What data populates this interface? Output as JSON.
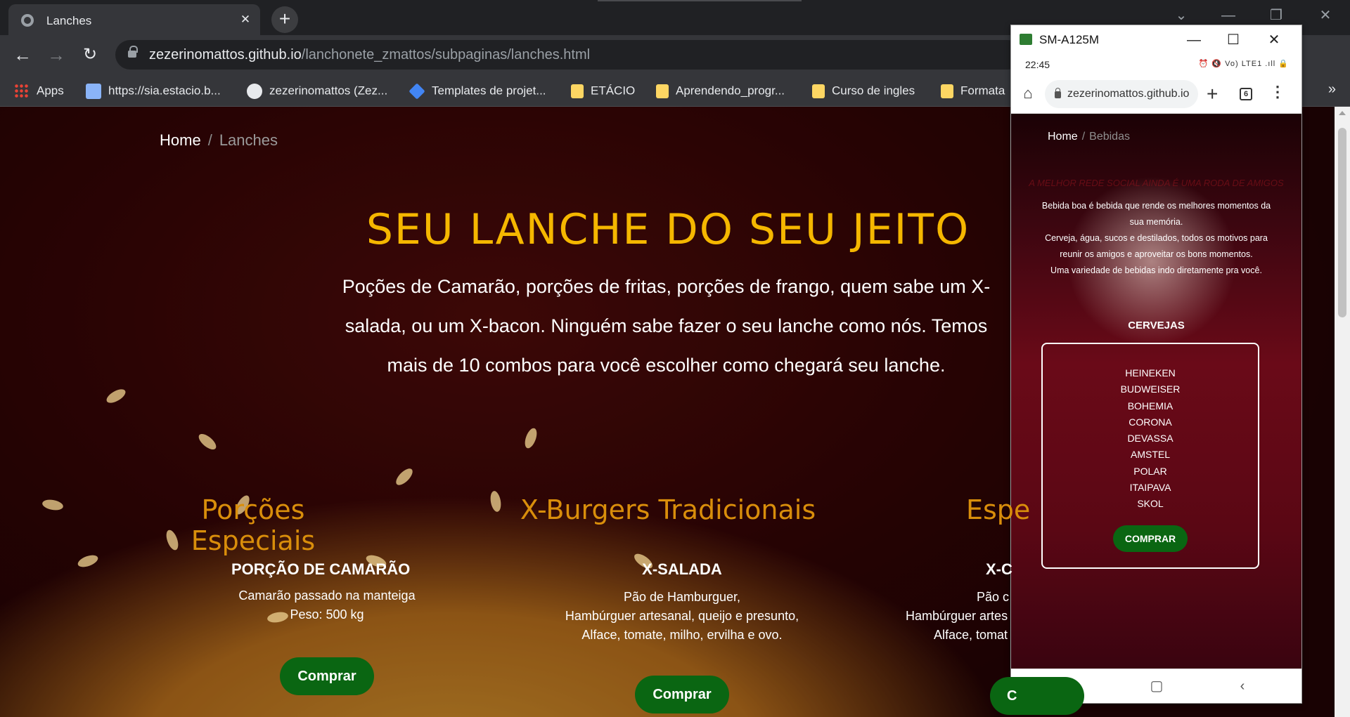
{
  "browser": {
    "tab_title": "Lanches",
    "url_host": "zezerinomattos.github.io",
    "url_path": "/lanchonete_zmattos/subpaginas/lanches.html",
    "bookmarks": [
      {
        "label": "Apps",
        "icon": "apps-grid-icon"
      },
      {
        "label": "https://sia.estacio.b...",
        "icon": "site-icon"
      },
      {
        "label": "zezerinomattos (Zez...",
        "icon": "github-icon"
      },
      {
        "label": "Templates de projet...",
        "icon": "diamond-icon"
      },
      {
        "label": "ETÁCIO",
        "icon": "folder-icon"
      },
      {
        "label": "Aprendendo_progr...",
        "icon": "folder-icon"
      },
      {
        "label": "Curso de ingles",
        "icon": "folder-icon"
      },
      {
        "label": "Formata",
        "icon": "folder-icon"
      }
    ],
    "bookmarks_overflow": "»"
  },
  "page": {
    "breadcrumb": {
      "home": "Home",
      "separator": "/",
      "current": "Lanches"
    },
    "hero": {
      "title": "SEU LANCHE DO SEU JEITO",
      "text": "Poções de Camarão, porções de fritas, porções de frango, quem sabe um X-salada, ou um X-bacon. Ninguém sabe fazer o seu lanche como nós. Temos mais de 10 combos para você escolher como chegará seu lanche."
    },
    "columns": [
      {
        "title": "Porções Especiais",
        "item_title": "PORÇÃO DE CAMARÃO",
        "desc_lines": [
          "Camarão passado na manteiga",
          "Peso: 500 kg"
        ],
        "button": "Comprar"
      },
      {
        "title": "X-Burgers Tradicionais",
        "item_title": "X-SALADA",
        "desc_lines": [
          "Pão de Hamburguer,",
          "Hambúrguer artesanal, queijo e presunto,",
          "Alface, tomate, milho, ervilha e ovo."
        ],
        "button": "Comprar"
      },
      {
        "title": "Espe",
        "item_title": "X-C",
        "desc_lines": [
          "Pão c",
          "Hambúrguer artes",
          "Alface, tomat"
        ],
        "button": "C"
      }
    ]
  },
  "phone_window": {
    "title": "SM-A125M",
    "status_time": "22:45",
    "status_icons": "⏰ 🔇 Vo) LTE1 .ıll 🔒",
    "url": "zezerinomattos.github.io",
    "tab_count": "6",
    "page": {
      "breadcrumb": {
        "home": "Home",
        "separator": "/",
        "current": "Bebidas"
      },
      "faded_heading": "A MELHOR REDE SOCIAL AINDA É UMA RODA DE AMIGOS",
      "intro_lines": [
        "Bebida boa é bebida que rende os melhores momentos da",
        "sua memória.",
        "Cerveja, água, sucos e destilados, todos os motivos para",
        "reunir os amigos e aproveitar os bons momentos.",
        "Uma variedade de bebidas indo diretamente pra você."
      ],
      "section_title": "CERVEJAS",
      "beers": [
        "HEINEKEN",
        "BUDWEISER",
        "BOHEMIA",
        "CORONA",
        "DEVASSA",
        "AMSTEL",
        "POLAR",
        "ITAIPAVA",
        "SKOL"
      ],
      "button": "COMPRAR"
    }
  },
  "colors": {
    "hero_title": "#f5b700",
    "column_title": "#d98e0b",
    "buy_button": "#0a6612"
  }
}
